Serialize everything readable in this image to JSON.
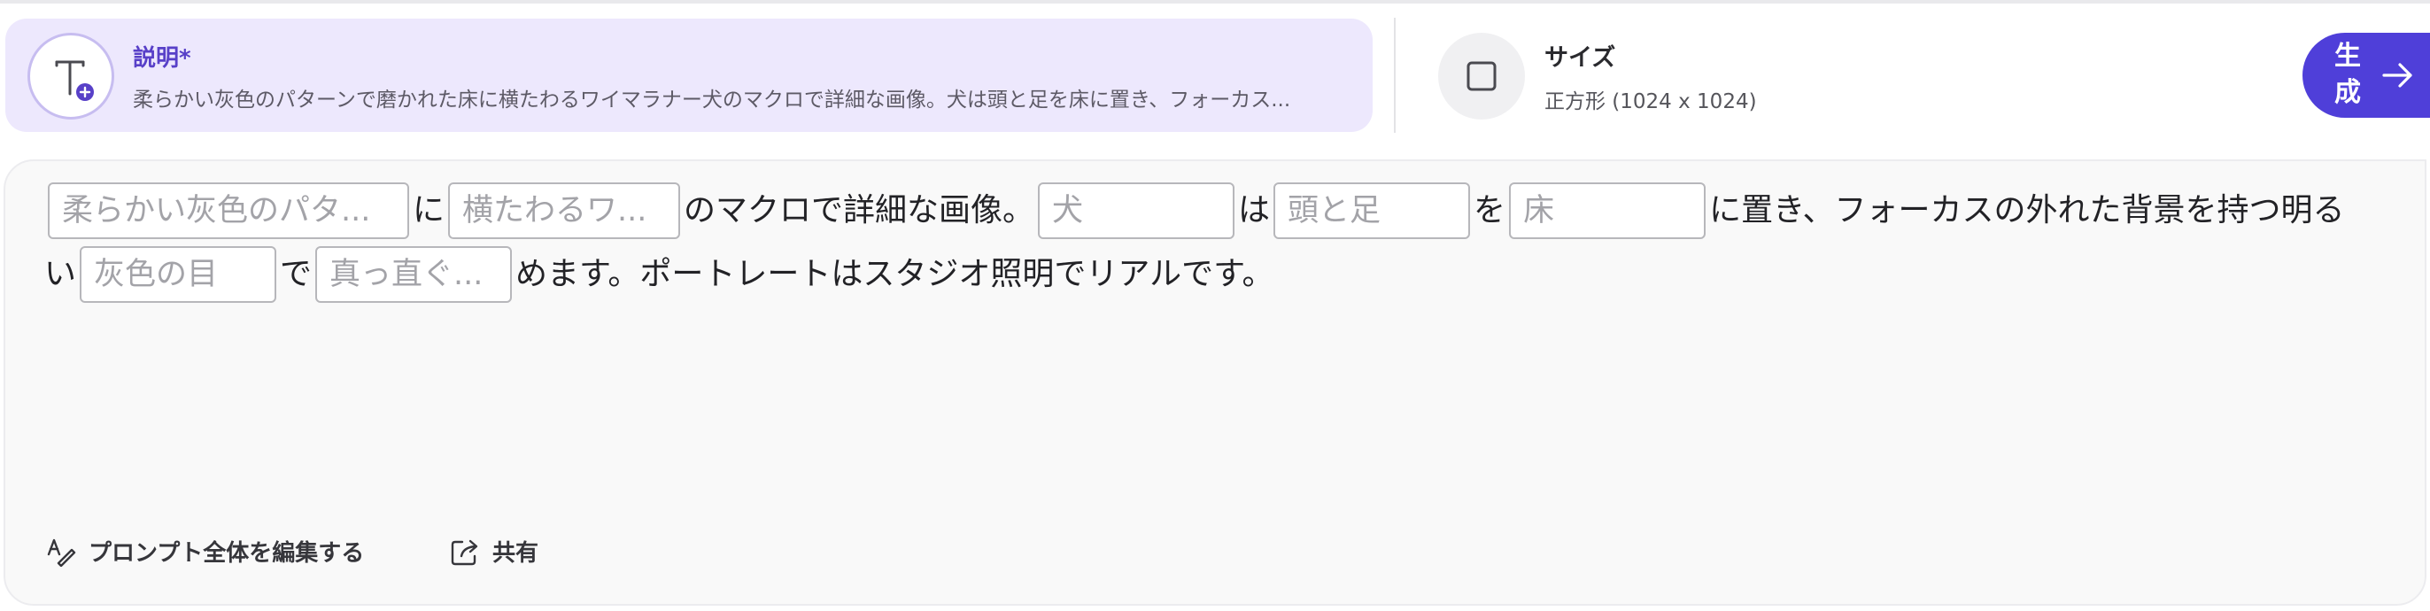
{
  "description": {
    "label": "説明*",
    "summary": "柔らかい灰色のパターンで磨かれた床に横たわるワイマラナー犬のマクロで詳細な画像。犬は頭と足を床に置き、フォーカス...",
    "icon": "text-add-icon"
  },
  "size": {
    "label": "サイズ",
    "value": "正方形 (1024 x 1024)",
    "icon": "square-icon"
  },
  "generate": {
    "label": "生成",
    "icon": "arrow-right-icon"
  },
  "prompt": {
    "line1": {
      "slot1": "柔らかい灰色のパタ...",
      "text1": "に",
      "slot2": "横たわるワ...",
      "text2": "のマクロで詳細な画像。",
      "slot3": "犬",
      "text3": "は",
      "slot4": "頭と足",
      "text4": "を",
      "slot5": "床",
      "text5": "に置き、フォーカスの外れた背景を持つ明る"
    },
    "line2": {
      "text1": "い",
      "slot6": "灰色の目",
      "text2": "で",
      "slot7": "真っ直ぐ...",
      "text3": "めます。ポートレートはスタジオ照明でリアルです。"
    }
  },
  "actions": {
    "edit_all": "プロンプト全体を編集する",
    "edit_all_icon": "edit-text-icon",
    "share": "共有",
    "share_icon": "share-icon"
  },
  "colors": {
    "accent": "#4f3fd9",
    "description_card_bg": "#ede8fd",
    "label_purple": "#5840c8"
  }
}
